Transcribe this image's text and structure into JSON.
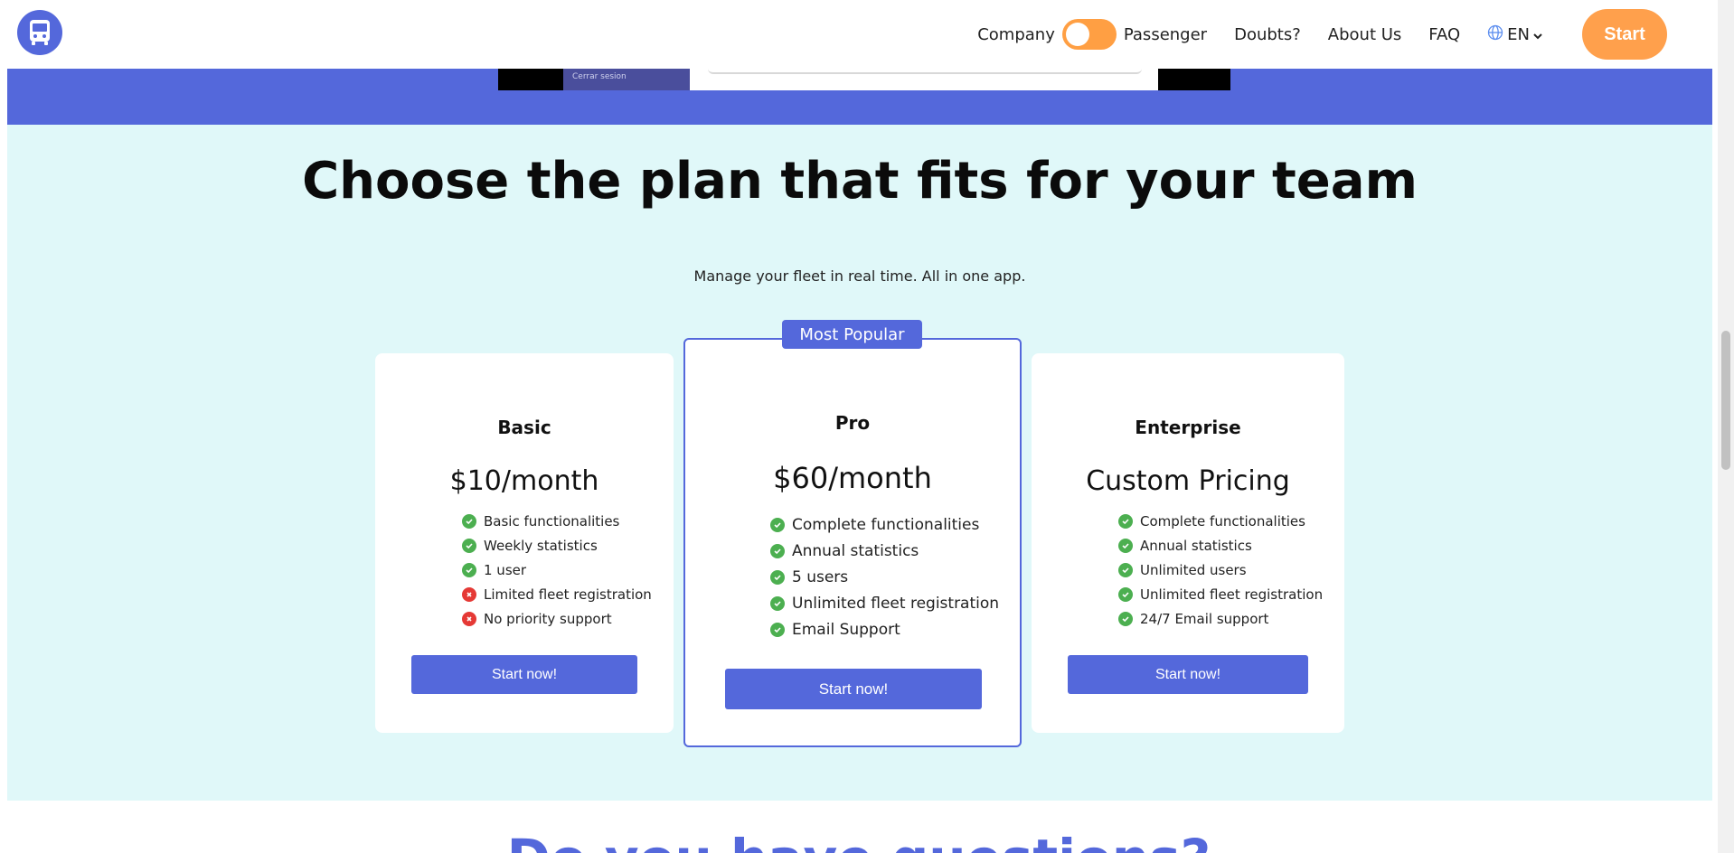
{
  "nav": {
    "company_label": "Company",
    "passenger_label": "Passenger",
    "doubts_label": "Doubts?",
    "about_label": "About Us",
    "faq_label": "FAQ",
    "language_label": "EN",
    "start_label": "Start",
    "accent_color": "#ffa04c"
  },
  "band": {
    "image_caption": "Cerrar sesion"
  },
  "pricing": {
    "title": "Choose the plan that fits for your team",
    "subtitle": "Manage your fleet in real time. All in one app.",
    "badge": "Most Popular",
    "plans": [
      {
        "name": "Basic",
        "price": "$10/month",
        "features": [
          {
            "text": "Basic functionalities",
            "included": true
          },
          {
            "text": "Weekly statistics",
            "included": true
          },
          {
            "text": "1 user",
            "included": true
          },
          {
            "text": "Limited fleet registration",
            "included": false
          },
          {
            "text": "No priority support",
            "included": false
          }
        ],
        "button": "Start now!"
      },
      {
        "name": "Pro",
        "price": "$60/month",
        "features": [
          {
            "text": "Complete functionalities",
            "included": true
          },
          {
            "text": "Annual statistics",
            "included": true
          },
          {
            "text": "5 users",
            "included": true
          },
          {
            "text": "Unlimited fleet registration",
            "included": true
          },
          {
            "text": "Email Support",
            "included": true
          }
        ],
        "button": "Start now!"
      },
      {
        "name": "Enterprise",
        "price": "Custom Pricing",
        "features": [
          {
            "text": "Complete functionalities",
            "included": true
          },
          {
            "text": "Annual statistics",
            "included": true
          },
          {
            "text": "Unlimited users",
            "included": true
          },
          {
            "text": "Unlimited fleet registration",
            "included": true
          },
          {
            "text": "24/7 Email support",
            "included": true
          }
        ],
        "button": "Start now!"
      }
    ]
  },
  "faq": {
    "title": "Do you have questions?"
  },
  "colors": {
    "primary": "#5468db",
    "section_bg": "#e0f8f9",
    "check": "#4caf50",
    "cross": "#e53935"
  }
}
